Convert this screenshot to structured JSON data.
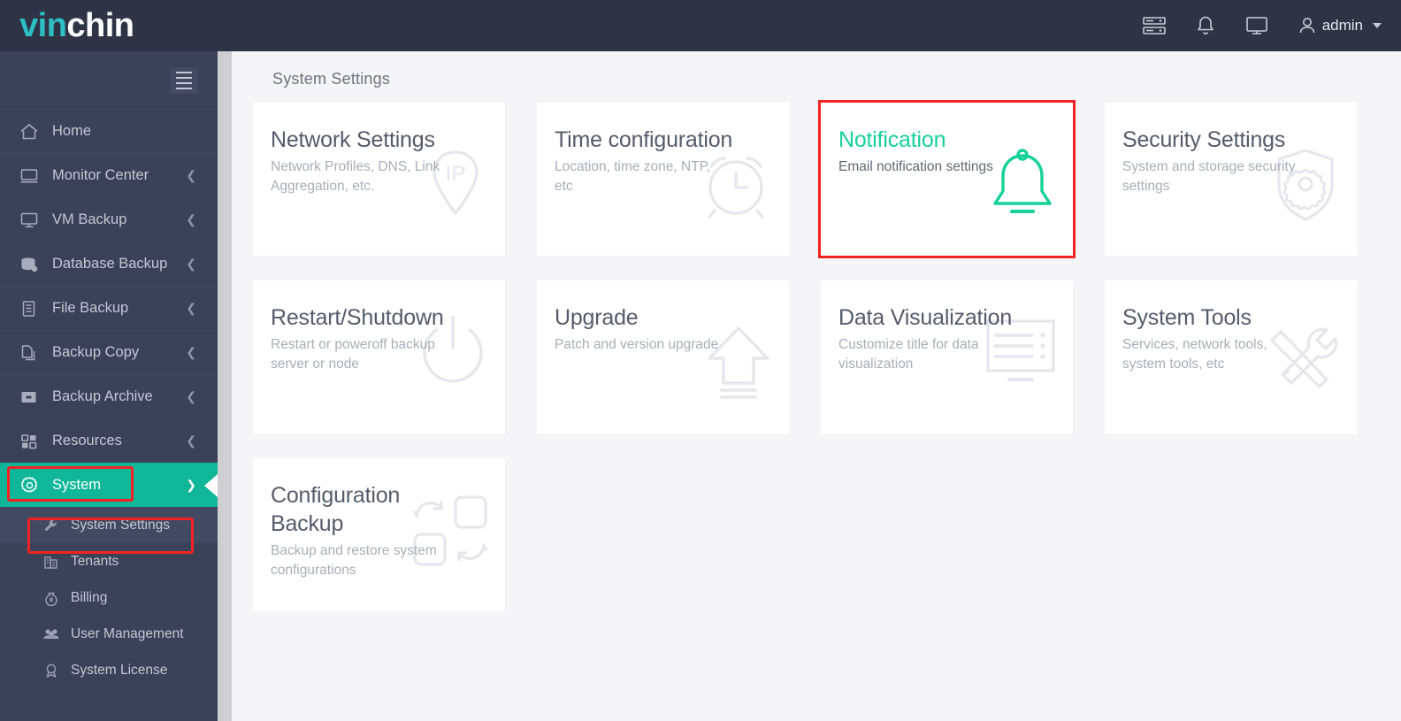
{
  "app": {
    "logo_part1": "vin",
    "logo_part2": "chin"
  },
  "header": {
    "icons": [
      "server-list-icon",
      "bell-icon",
      "monitor-icon"
    ],
    "user": "admin",
    "user_icon": "user-icon",
    "caret": "chevron-down-icon"
  },
  "sidebar": {
    "collapse_icon": "hamburger-icon",
    "items": [
      {
        "label": "Home",
        "icon": "home-icon",
        "expandable": false,
        "active": false
      },
      {
        "label": "Monitor Center",
        "icon": "monitor-icon",
        "expandable": true,
        "active": false
      },
      {
        "label": "VM Backup",
        "icon": "display-icon",
        "expandable": true,
        "active": false
      },
      {
        "label": "Database Backup",
        "icon": "database-icon",
        "expandable": true,
        "active": false
      },
      {
        "label": "File Backup",
        "icon": "file-icon",
        "expandable": true,
        "active": false
      },
      {
        "label": "Backup Copy",
        "icon": "copy-icon",
        "expandable": true,
        "active": false
      },
      {
        "label": "Backup Archive",
        "icon": "archive-icon",
        "expandable": true,
        "active": false
      },
      {
        "label": "Resources",
        "icon": "grid-icon",
        "expandable": true,
        "active": false
      },
      {
        "label": "System",
        "icon": "gear-icon",
        "expandable": true,
        "active": true
      }
    ],
    "subitems": [
      {
        "label": "System Settings",
        "icon": "wrench-icon",
        "selected": true
      },
      {
        "label": "Tenants",
        "icon": "building-icon",
        "selected": false
      },
      {
        "label": "Billing",
        "icon": "money-bag-icon",
        "selected": false
      },
      {
        "label": "User Management",
        "icon": "users-icon",
        "selected": false
      },
      {
        "label": "System License",
        "icon": "award-icon",
        "selected": false
      }
    ]
  },
  "main": {
    "page_title": "System Settings",
    "cards": [
      {
        "title": "Network Settings",
        "desc": "Network Profiles, DNS, Link Aggregation, etc.",
        "icon": "ip-location-pin-icon",
        "active": false
      },
      {
        "title": "Time configuration",
        "desc": "Location, time zone, NTP, etc",
        "icon": "alarm-clock-icon",
        "active": false
      },
      {
        "title": "Notification",
        "desc": "Email notification settings",
        "icon": "bell-icon",
        "active": true
      },
      {
        "title": "Security Settings",
        "desc": "System and storage security settings",
        "icon": "shield-gear-icon",
        "active": false
      },
      {
        "title": "Restart/Shutdown",
        "desc": "Restart or poweroff backup server or node",
        "icon": "power-icon",
        "active": false
      },
      {
        "title": "Upgrade",
        "desc": "Patch and version upgrade",
        "icon": "upload-arrow-icon",
        "active": false
      },
      {
        "title": "Data Visualization",
        "desc": "Customize title for data visualization",
        "icon": "dashboard-screen-icon",
        "active": false
      },
      {
        "title": "System Tools",
        "desc": "Services, network tools, system tools, etc",
        "icon": "wrench-screwdriver-icon",
        "active": false
      },
      {
        "title": "Configuration Backup",
        "desc": "Backup and restore system configurations",
        "icon": "sync-squares-icon",
        "active": false
      }
    ]
  },
  "colors": {
    "brand_teal": "#0fb698",
    "accent_green": "#16d198",
    "annotation_red": "#f42222",
    "sidebar_bg": "#3b4257",
    "topbar_bg": "#2e3446"
  }
}
